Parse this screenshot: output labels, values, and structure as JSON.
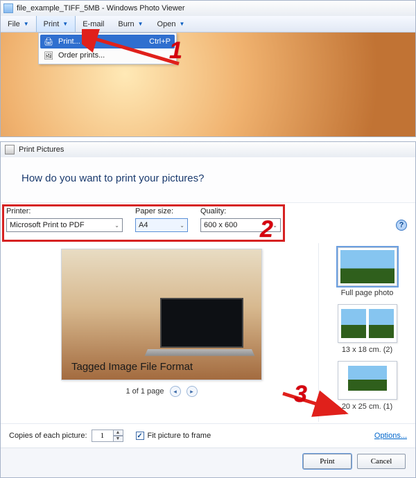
{
  "annotation": {
    "n1": "1",
    "n2": "2",
    "n3": "3"
  },
  "pv": {
    "title": "file_example_TIFF_5MB - Windows Photo Viewer",
    "menu": {
      "file": "File",
      "print": "Print",
      "email": "E-mail",
      "burn": "Burn",
      "open": "Open"
    },
    "dropdown": {
      "print": "Print...",
      "print_key": "Ctrl+P",
      "order_prints": "Order prints..."
    }
  },
  "dlg": {
    "title": "Print Pictures",
    "heading": "How do you want to print your pictures?",
    "help_aria": "Help",
    "printer_label": "Printer:",
    "printer_value": "Microsoft Print to PDF",
    "paper_label": "Paper size:",
    "paper_value": "A4",
    "quality_label": "Quality:",
    "quality_value": "600 x 600",
    "preview_caption": "Tagged Image File Format",
    "pager_text": "1 of 1 page",
    "layouts": {
      "full": "Full page photo",
      "l13": "13 x 18 cm. (2)",
      "l20": "20 x 25 cm. (1)"
    },
    "copies_label": "Copies of each picture:",
    "copies_value": "1",
    "fit_label": "Fit picture to frame",
    "options": "Options...",
    "print_btn": "Print",
    "cancel_btn": "Cancel"
  }
}
